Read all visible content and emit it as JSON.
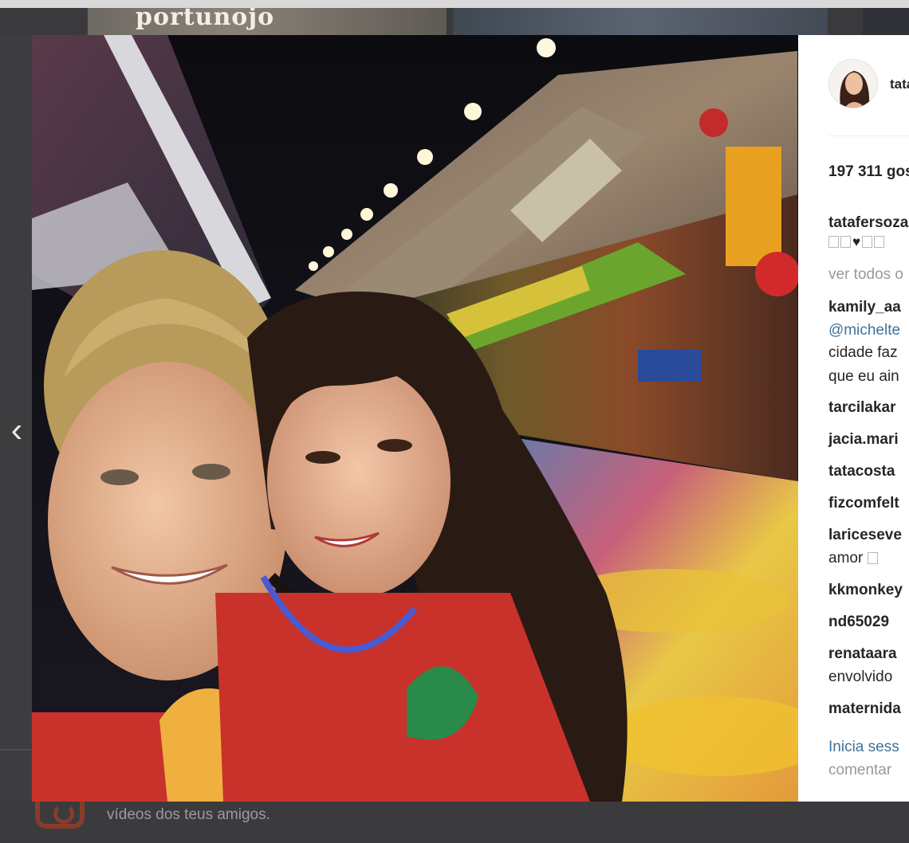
{
  "background": {
    "strip_logo_text": "portunojo",
    "footer_text": "vídeos dos teus amigos."
  },
  "nav": {
    "prev_arrow": "‹"
  },
  "photo": {
    "alt_subject": "selfie"
  },
  "post": {
    "username": "tatafersoza",
    "likes": "197 311 gos",
    "caption_user": "tatafersozа",
    "caption_emoji_text": "♥",
    "view_all": "ver todos o",
    "comments": [
      {
        "user": "kamily_aa",
        "lines": [
          "@michelte",
          "cidade faz",
          "que eu ain"
        ]
      },
      {
        "user": "tarcilakar",
        "lines": []
      },
      {
        "user": "jacia.mari",
        "lines": []
      },
      {
        "user": "tatacosta",
        "lines": []
      },
      {
        "user": "fizcomfelt",
        "lines": []
      },
      {
        "user": "lariceseve",
        "lines": [
          "amor"
        ]
      },
      {
        "user": "kkmonkey",
        "lines": []
      },
      {
        "user": "nd65029",
        "lines": []
      },
      {
        "user": "renataara",
        "lines": [
          "envolvido"
        ]
      },
      {
        "user": "maternida",
        "lines": []
      }
    ],
    "login_link": "Inicia sess",
    "comment_prompt": "comentar"
  },
  "colors": {
    "link": "#3f729b",
    "muted": "#999999",
    "text": "#262626"
  }
}
